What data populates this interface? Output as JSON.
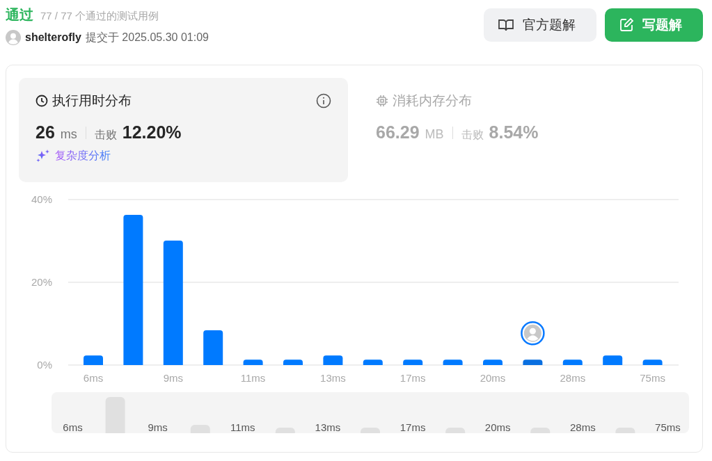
{
  "result": {
    "status": "通过",
    "summary": "77 / 77 个通过的测试用例"
  },
  "submission": {
    "user": "shelterofly",
    "submitted_at": "提交于 2025.05.30 01:09"
  },
  "buttons": [
    {
      "kind": "official",
      "label": "官方题解"
    },
    {
      "kind": "write",
      "label": "写题解"
    }
  ],
  "panels": [
    {
      "kind": "runtime",
      "title": "执行用时分布",
      "value": "26",
      "unit": "ms",
      "beats_label": "击败",
      "beats": "12.20%",
      "selected": true,
      "link": "复杂度分析"
    },
    {
      "kind": "memory",
      "title": "消耗内存分布",
      "value": "66.29",
      "unit": "MB",
      "beats_label": "击败",
      "beats": "8.54%",
      "selected": false
    }
  ],
  "runtime_chart": {
    "chart_data": {
      "type": "bar",
      "categories": [
        "6ms",
        null,
        "9ms",
        null,
        "11ms",
        null,
        "13ms",
        null,
        "17ms",
        null,
        "20ms",
        null,
        "28ms",
        null,
        "75ms"
      ],
      "values": [
        2.3,
        36.3,
        30.1,
        8.4,
        1.3,
        1.3,
        2.3,
        1.3,
        1.3,
        1.3,
        1.3,
        1.3,
        1.3,
        2.3,
        1.3
      ],
      "ylim": [
        0,
        40
      ],
      "yticks": [
        {
          "value": 0,
          "label": "0%"
        },
        {
          "value": 20,
          "label": "20%"
        },
        {
          "value": 40,
          "label": "40%"
        }
      ]
    },
    "bars": [
      {
        "selected": false
      },
      {
        "selected": false
      },
      {
        "selected": false
      },
      {
        "selected": false
      },
      {
        "selected": false
      },
      {
        "selected": false
      },
      {
        "selected": false
      },
      {
        "selected": false
      },
      {
        "selected": false
      },
      {
        "selected": false
      },
      {
        "selected": false
      },
      {
        "selected": true
      },
      {
        "selected": false
      },
      {
        "selected": false
      },
      {
        "selected": false
      }
    ]
  },
  "overview_labels": [
    "6ms",
    "9ms",
    "11ms",
    "13ms",
    "17ms",
    "20ms",
    "28ms",
    "75ms"
  ]
}
